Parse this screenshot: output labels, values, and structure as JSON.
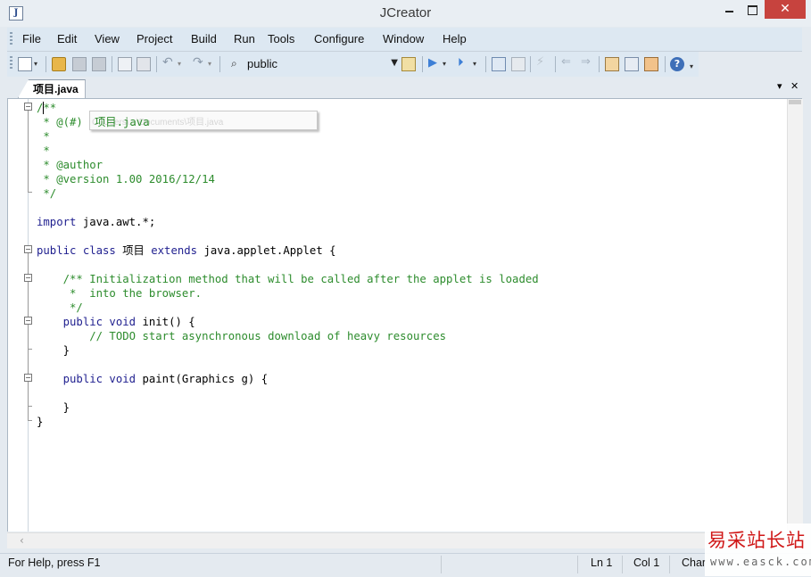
{
  "window": {
    "title": "JCreator",
    "close_glyph": "✕"
  },
  "menu": {
    "items": [
      {
        "label": "File"
      },
      {
        "label": "Edit"
      },
      {
        "label": "View"
      },
      {
        "label": "Project"
      },
      {
        "label": "Build"
      },
      {
        "label": "Run"
      },
      {
        "label": "Tools"
      },
      {
        "label": "Configure"
      },
      {
        "label": "Window"
      },
      {
        "label": "Help"
      }
    ]
  },
  "toolbar": {
    "search_combo_value": "public",
    "icons": [
      "new-file-icon",
      "open-folder-icon",
      "save-icon",
      "save-all-icon",
      "copy-icon",
      "paste-icon",
      "undo-icon",
      "redo-icon",
      "find-icon",
      "find-in-files-icon",
      "run-icon",
      "run-project-icon",
      "compile-icon",
      "compile-project-icon",
      "debug-icon",
      "back-icon",
      "forward-icon",
      "view-icon",
      "project-icon",
      "options-icon",
      "help-icon"
    ]
  },
  "tabs": {
    "active": "项目.java"
  },
  "editor": {
    "tooltip_text": "项目.java",
    "tooltip_faded": "C:\\Users\\...\\Documents\\项目.java",
    "lines": [
      {
        "parts": [
          {
            "t": "/**",
            "s": "c"
          }
        ]
      },
      {
        "parts": [
          {
            "t": " * @(#)",
            "s": "c"
          }
        ]
      },
      {
        "parts": [
          {
            "t": " *",
            "s": "c"
          }
        ]
      },
      {
        "parts": [
          {
            "t": " *",
            "s": "c"
          }
        ]
      },
      {
        "parts": [
          {
            "t": " * @author",
            "s": "c"
          }
        ]
      },
      {
        "parts": [
          {
            "t": " * @version 1.00 2016/12/14",
            "s": "c"
          }
        ]
      },
      {
        "parts": [
          {
            "t": " */",
            "s": "c"
          }
        ]
      },
      {
        "parts": []
      },
      {
        "parts": [
          {
            "t": "import",
            "s": "k"
          },
          {
            "t": " java.awt.*;",
            "s": "n"
          }
        ]
      },
      {
        "parts": []
      },
      {
        "parts": [
          {
            "t": "public class",
            "s": "k"
          },
          {
            "t": " 项目 ",
            "s": "n"
          },
          {
            "t": "extends",
            "s": "k"
          },
          {
            "t": " java.applet.Applet {",
            "s": "n"
          }
        ]
      },
      {
        "parts": []
      },
      {
        "parts": [
          {
            "t": "    /** Initialization method that will be called after the applet is loaded",
            "s": "c"
          }
        ]
      },
      {
        "parts": [
          {
            "t": "     *  into the browser.",
            "s": "c"
          }
        ]
      },
      {
        "parts": [
          {
            "t": "     */",
            "s": "c"
          }
        ]
      },
      {
        "parts": [
          {
            "t": "    public void",
            "s": "k"
          },
          {
            "t": " init() {",
            "s": "n"
          }
        ]
      },
      {
        "parts": [
          {
            "t": "        // TODO start asynchronous download of heavy resources",
            "s": "c"
          }
        ]
      },
      {
        "parts": [
          {
            "t": "    }",
            "s": "n"
          }
        ]
      },
      {
        "parts": []
      },
      {
        "parts": [
          {
            "t": "    public void",
            "s": "k"
          },
          {
            "t": " paint(Graphics g) {",
            "s": "n"
          }
        ]
      },
      {
        "parts": []
      },
      {
        "parts": [
          {
            "t": "    }",
            "s": "n"
          }
        ]
      },
      {
        "parts": [
          {
            "t": "}",
            "s": "n"
          }
        ]
      }
    ]
  },
  "status": {
    "help": "For Help, press F1",
    "line": "Ln 1",
    "col": "Col 1",
    "char": "Char"
  },
  "watermark": {
    "title": "易采站长站",
    "url": "www.easck.com"
  },
  "colors": {
    "comment": "#2d8c2d",
    "keyword": "#1f1f8f",
    "close_button": "#c7433e",
    "watermark": "#d01818"
  }
}
